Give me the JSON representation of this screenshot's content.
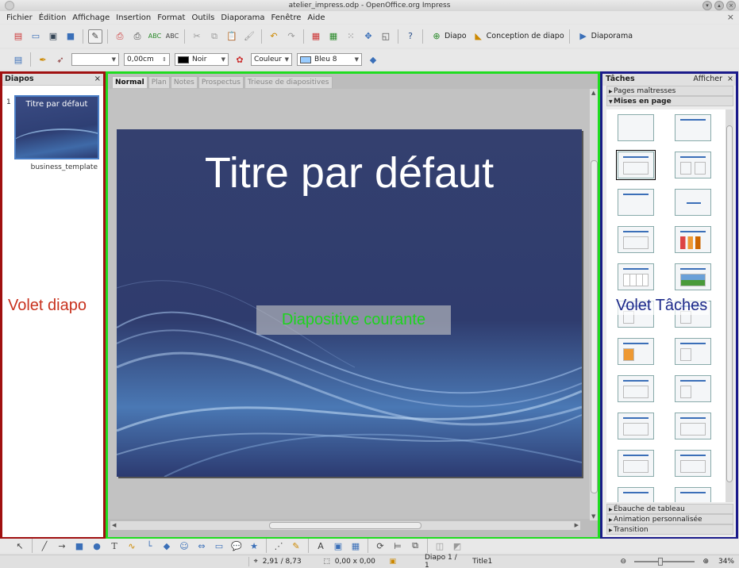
{
  "window": {
    "title": "atelier_impress.odp - OpenOffice.org Impress"
  },
  "menu": [
    "Fichier",
    "Édition",
    "Affichage",
    "Insertion",
    "Format",
    "Outils",
    "Diaporama",
    "Fenêtre",
    "Aide"
  ],
  "toolbar": {
    "slide_label": "Diapo",
    "slide_design_label": "Conception de diapo",
    "slideshow_label": "Diaporama"
  },
  "format_toolbar": {
    "line_style": "",
    "line_width": "0,00cm",
    "line_color": "Noir",
    "area_style": "Couleur",
    "area_color": "Bleu 8",
    "colors": {
      "line": "#000000",
      "area": "#99ccff"
    }
  },
  "slides_pane": {
    "title": "Diapos",
    "slide_number": "1",
    "thumbnail_title": "Titre par défaut",
    "thumbnail_caption": "business_template",
    "overlay_label": "Volet diapo"
  },
  "center": {
    "tabs": [
      {
        "label": "Normal",
        "active": true
      },
      {
        "label": "Plan",
        "active": false
      },
      {
        "label": "Notes",
        "active": false
      },
      {
        "label": "Prospectus",
        "active": false
      },
      {
        "label": "Trieuse de diapositives",
        "active": false
      }
    ],
    "slide_title": "Titre par défaut",
    "overlay_label": "Diapositive courante"
  },
  "tasks_pane": {
    "title": "Tâches",
    "show_label": "Afficher",
    "sections_top": [
      "Pages maîtresses",
      "Mises en page"
    ],
    "sections_bottom": [
      "Ébauche de tableau",
      "Animation personnalisée",
      "Transition"
    ],
    "overlay_label": "Volet Tâches"
  },
  "status": {
    "position": "2,91 / 8,73",
    "size": "0,00 x 0,00",
    "slide": "Diapo 1 / 1",
    "layout": "Title1",
    "zoom": "34%"
  },
  "overlay_colors": {
    "slides": "#a01010",
    "center": "#1fdc1f",
    "tasks": "#1a1a8a"
  }
}
